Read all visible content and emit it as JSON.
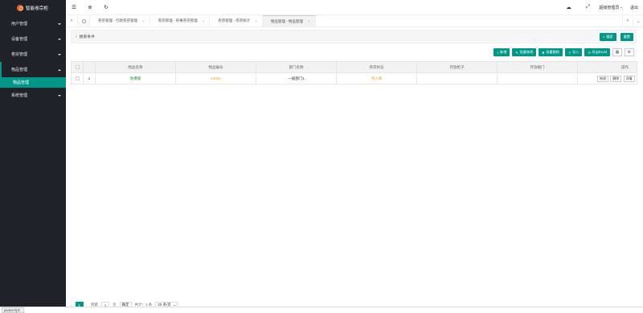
{
  "app": {
    "title": "智能卷宗柜"
  },
  "sidebar": {
    "items": [
      {
        "label": "用户管理"
      },
      {
        "label": "设备管理"
      },
      {
        "label": "卷宗管理"
      },
      {
        "label": "物品管理",
        "sub": [
          {
            "label": "物品管理"
          }
        ]
      },
      {
        "label": "系统管理"
      }
    ]
  },
  "header": {
    "icons": [
      "menu-icon",
      "globe-icon",
      "refresh-icon"
    ],
    "right_icons": [
      "cloud-icon",
      "fullscreen-icon"
    ],
    "user": "超级管理员",
    "logout": "退出"
  },
  "tabs": {
    "items": [
      {
        "label": "卷宗管理 - 行政卷宗管理"
      },
      {
        "label": "卷宗管理 - 刑事卷宗管理"
      },
      {
        "label": "卷宗管理 - 卷宗统计"
      },
      {
        "label": "物品管理 - 物品管理",
        "active": true
      }
    ]
  },
  "search": {
    "label": "搜索条件",
    "search_btn": "搜索",
    "reset_btn": "重置"
  },
  "toolbar": {
    "add": "新增",
    "batch_edit": "批量修改",
    "batch_delete": "批量删除",
    "import": "导入",
    "export": "导出Excel"
  },
  "table": {
    "columns": [
      "物品名称",
      "物品编号",
      "部门名称",
      "卷宗状态",
      "存放柜子",
      "存放箱门",
      "操作"
    ],
    "rows": [
      {
        "index": "1",
        "name": "防爆服",
        "code": "10001",
        "dept": "一级部门1",
        "status": "待入库",
        "cabinet": "",
        "door": "",
        "ops": [
          "修改",
          "删除",
          "详情"
        ]
      }
    ]
  },
  "pager": {
    "current": "1",
    "goto_label": "到第",
    "page_input": "1",
    "page_unit": "页",
    "confirm": "确定",
    "total": "共计：1 条",
    "page_size": "20 条/页"
  },
  "statusbar": {
    "text": "javascript:;"
  }
}
